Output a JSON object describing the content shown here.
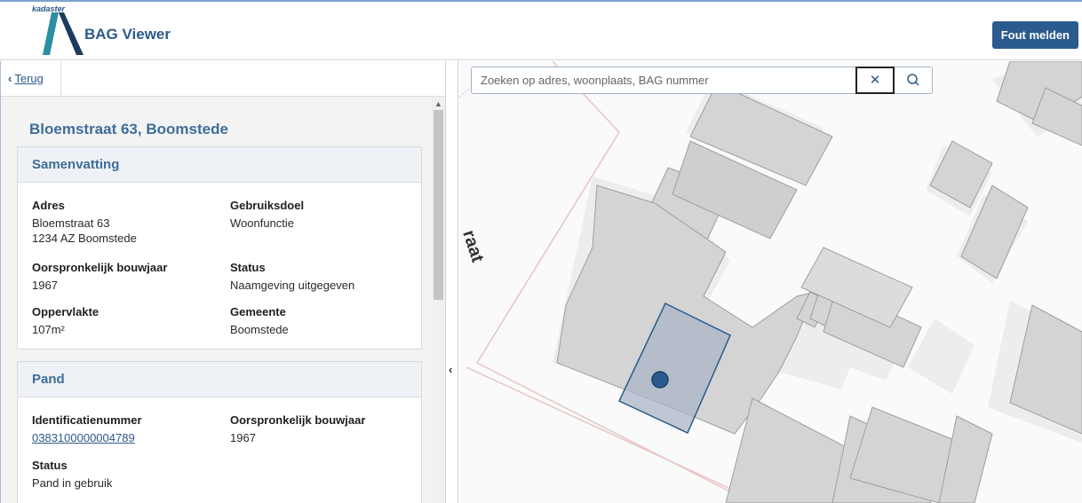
{
  "header": {
    "brand": "kadaster",
    "app_title": "BAG Viewer",
    "report_button": "Fout melden",
    "brand_color": "#2b5b8e"
  },
  "nav": {
    "back_label": "Terug"
  },
  "detail": {
    "address_title": "Bloemstraat 63, Boomstede",
    "summary": {
      "heading": "Samenvatting",
      "adres_label": "Adres",
      "adres_line1": "Bloemstraat 63",
      "adres_line2": "1234 AZ Boomstede",
      "gebruiksdoel_label": "Gebruiksdoel",
      "gebruiksdoel_value": "Woonfunctie",
      "bouwjaar_label": "Oorspronkelijk bouwjaar",
      "bouwjaar_value": "1967",
      "status_label": "Status",
      "status_value": "Naamgeving uitgegeven",
      "oppervlakte_label": "Oppervlakte",
      "oppervlakte_value": "107m²",
      "gemeente_label": "Gemeente",
      "gemeente_value": "Boomstede"
    },
    "pand": {
      "heading": "Pand",
      "id_label": "Identificatienummer",
      "id_value": "0383100000004789",
      "bouwjaar_label": "Oorspronkelijk bouwjaar",
      "bouwjaar_value": "1967",
      "status_label": "Status",
      "status_value": "Pand in gebruik"
    }
  },
  "map": {
    "street_label": "raat",
    "search_placeholder": "Zoeken op adres, woonplaats, BAG nummer",
    "building_color": "#d4d4d4",
    "selected_color": "#2b5b8e"
  }
}
